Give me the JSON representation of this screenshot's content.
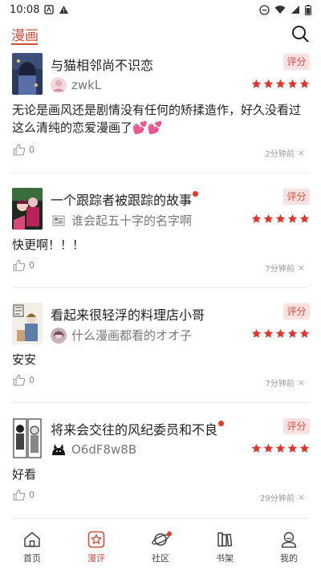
{
  "status_bar": {
    "time": "10:08"
  },
  "header": {
    "tab_label": "漫画",
    "accent": "#d24b3b"
  },
  "reviews": [
    {
      "title": "与猫相邻尚不识恋",
      "has_dot": false,
      "rate_label": "评分",
      "username": "zwkL",
      "rating": 5,
      "content": "无论是画风还是剧情没有任何的矫揉造作，好久没看过这么清纯的恋爱漫画了💕💕",
      "likes": "0",
      "time": "2分钟前"
    },
    {
      "title": "一个跟踪者被跟踪的故事",
      "has_dot": true,
      "rate_label": "评分",
      "username": "谁会起五十字的名字啊",
      "rating": 5,
      "content": "快更啊！！！",
      "likes": "0",
      "time": "7分钟前"
    },
    {
      "title": "看起来很轻浮的料理店小哥",
      "has_dot": false,
      "rate_label": "评分",
      "username": "什么漫画都看的オオ子",
      "rating": 5,
      "content": "安安",
      "likes": "0",
      "time": "7分钟前"
    },
    {
      "title": "将来会交往的风纪委员和不良",
      "has_dot": true,
      "rate_label": "评分",
      "username": "O6dF8w8B",
      "rating": 5,
      "content": "好看",
      "likes": "0",
      "time": "29分钟前"
    }
  ],
  "close_symbol": "×",
  "bottom_nav": [
    {
      "label": "首页",
      "icon": "home-icon",
      "active": false
    },
    {
      "label": "漫评",
      "icon": "star-review-icon",
      "active": true
    },
    {
      "label": "社区",
      "icon": "planet-icon",
      "active": false,
      "badge": true
    },
    {
      "label": "书架",
      "icon": "bookshelf-icon",
      "active": false
    },
    {
      "label": "我的",
      "icon": "profile-icon",
      "active": false
    }
  ],
  "colors": {
    "star": "#e2342a",
    "rate_tag_bg": "#fbe1df",
    "rate_tag_text": "#e04a3c"
  }
}
